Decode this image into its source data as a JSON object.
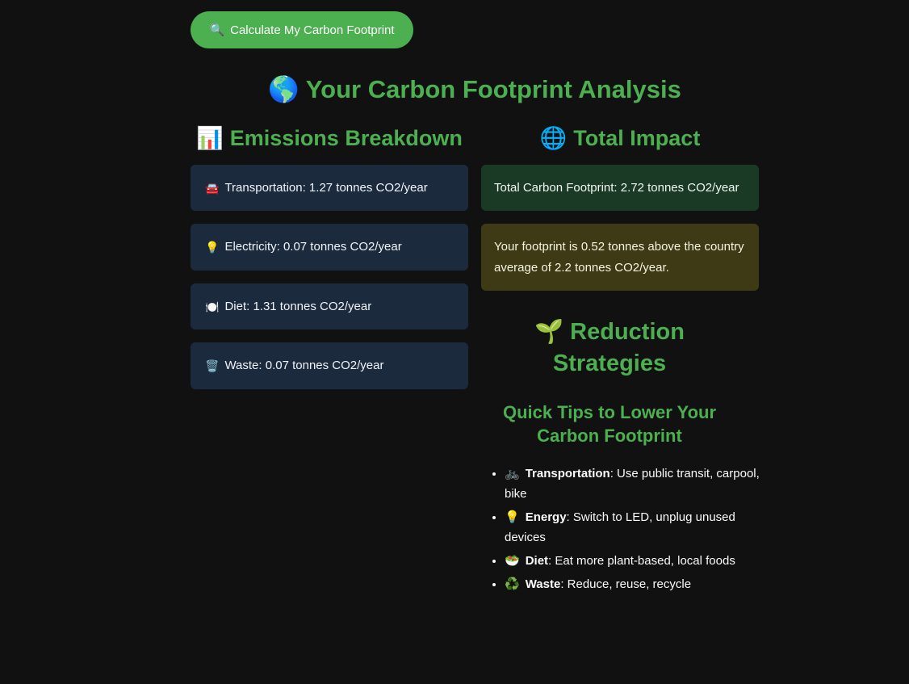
{
  "calculate_button": {
    "icon": "magnifier-icon",
    "glyph": "🔍",
    "label": "Calculate My Carbon Footprint"
  },
  "title": {
    "glyph": "🌎",
    "text": "Your Carbon Footprint Analysis"
  },
  "breakdown": {
    "heading_glyph": "📊",
    "heading": "Emissions Breakdown",
    "items": [
      {
        "glyph": "🚘",
        "icon": "car-icon",
        "text": "Transportation: 1.27 tonnes CO2/year"
      },
      {
        "glyph": "💡",
        "icon": "lightbulb-icon",
        "text": "Electricity: 0.07 tonnes CO2/year"
      },
      {
        "glyph": "🍽️",
        "icon": "plate-icon",
        "text": "Diet: 1.31 tonnes CO2/year"
      },
      {
        "glyph": "🗑️",
        "icon": "trash-icon",
        "text": "Waste: 0.07 tonnes CO2/year"
      }
    ]
  },
  "total_impact": {
    "heading_glyph": "🌐",
    "heading": "Total Impact",
    "total_text": "Total Carbon Footprint: 2.72 tonnes CO2/year",
    "comparison_text": "Your footprint is 0.52 tonnes above the country average of 2.2 tonnes CO2/year."
  },
  "strategies": {
    "heading_glyph": "🌱",
    "heading": "Reduction Strategies",
    "tips_heading": "Quick Tips to Lower Your Carbon Footprint",
    "tips": [
      {
        "glyph": "🚲",
        "icon": "bicycle-icon",
        "label": "Transportation",
        "text": ": Use public transit, carpool, bike"
      },
      {
        "glyph": "💡",
        "icon": "lightbulb-icon",
        "label": "Energy",
        "text": ": Switch to LED, unplug unused devices"
      },
      {
        "glyph": "🥗",
        "icon": "salad-icon",
        "label": "Diet",
        "text": ": Eat more plant-based, local foods"
      },
      {
        "glyph": "♻️",
        "icon": "recycle-icon",
        "label": "Waste",
        "text": ": Reduce, reuse, recycle"
      }
    ]
  },
  "colors": {
    "background": "#111111",
    "accent_green": "#4caf50",
    "card_blue": "#1c2a3e",
    "card_green": "#1b3a26",
    "card_yellow": "#3d3a15"
  }
}
